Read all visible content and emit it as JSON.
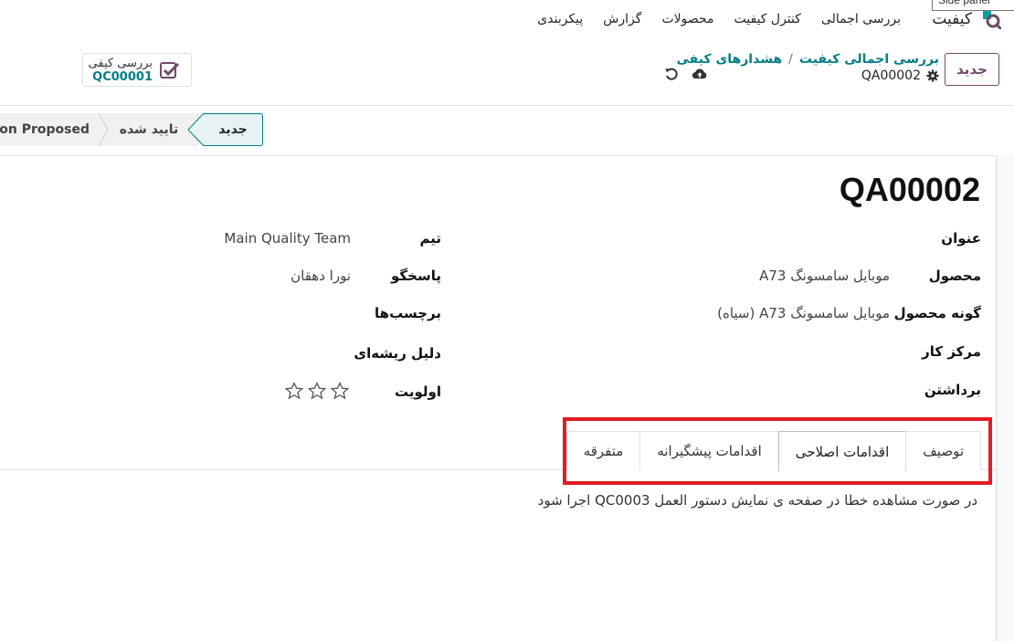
{
  "app": {
    "name": "کیفیت",
    "tooltip": "Side panel"
  },
  "menu": [
    "بررسی اجمالی",
    "کنترل کیفیت",
    "محصولات",
    "گزارش",
    "پیکربندی"
  ],
  "control": {
    "new_label": "جدید",
    "breadcrumb": [
      "بررسی اجمالی کیفیت",
      "هشدارهای کیفی"
    ],
    "breadcrumb_sep": "/",
    "record_id": "QA00002",
    "smart_button": {
      "title": "بررسی کیفی",
      "value": "QC00001"
    }
  },
  "stages": {
    "current": "جدید",
    "approved": "تایید شده",
    "proposed": "Action Proposed"
  },
  "record": {
    "title": "QA00002"
  },
  "fields_right": [
    {
      "label": "عنوان",
      "value": ""
    },
    {
      "label": "محصول",
      "value": "موبایل سامسونگ A73"
    },
    {
      "label": "گونه محصول",
      "value": "موبایل سامسونگ A73 (سیاه)"
    },
    {
      "label": "مرکز کار",
      "value": ""
    },
    {
      "label": "برداشتن",
      "value": ""
    }
  ],
  "fields_left": [
    {
      "label": "تیم",
      "value": "Main Quality Team"
    },
    {
      "label": "پاسخگو",
      "value": "نورا دهقان"
    },
    {
      "label": "برچسب‌ها",
      "value": ""
    },
    {
      "label": "دلیل ریشه‌ای",
      "value": ""
    },
    {
      "label": "اولویت",
      "value": ""
    }
  ],
  "priority": {
    "stars_filled": 0,
    "stars_total": 3
  },
  "tabs": [
    {
      "label": "توصیف"
    },
    {
      "label": "اقدامات اصلاحی"
    },
    {
      "label": "اقدامات پیشگیرانه"
    },
    {
      "label": "متفرقه"
    }
  ],
  "active_tab": "اقدامات اصلاحی",
  "tab_content": "در صورت مشاهده خطا در صفحه ی نمایش دستور العمل QC0003 اجرا شود",
  "colors": {
    "accent": "#017e84",
    "brand": "#714b67",
    "highlight": "#e31b23"
  }
}
